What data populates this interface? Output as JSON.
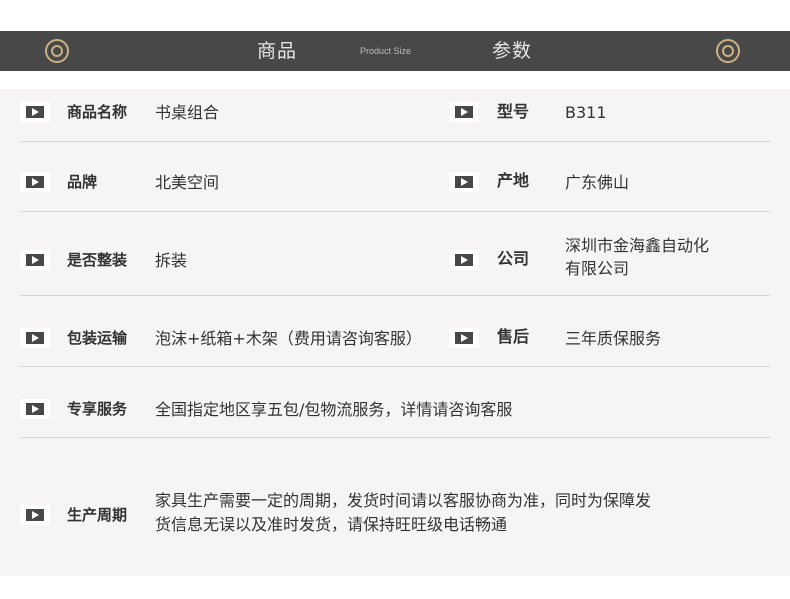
{
  "header": {
    "title_left": "商品",
    "subtitle": "Product Size",
    "title_right": "参数"
  },
  "rows": [
    {
      "label": "商品名称",
      "value": "书桌组合",
      "label2": "型号",
      "value2": "B311"
    },
    {
      "label": "品牌",
      "value": "北美空间",
      "label2": "产地",
      "value2": "广东佛山"
    },
    {
      "label": "是否整装",
      "value": "拆装",
      "label2": "公司",
      "value2_line1": "深圳市金海鑫自动化",
      "value2_line2": "有限公司"
    },
    {
      "label": "包装运输",
      "value": "泡沫+纸箱+木架（费用请咨询客服）",
      "label2": "售后",
      "value2": "三年质保服务"
    },
    {
      "label": "专享服务",
      "value": "全国指定地区享五包/包物流服务，详情请咨询客服"
    },
    {
      "label": "生产周期",
      "value_line1": "家具生产需要一定的周期，发货时间请以客服协商为准，同时为保障发",
      "value_line2": "货信息无误以及准时发货，请保持旺旺级电话畅通"
    }
  ]
}
